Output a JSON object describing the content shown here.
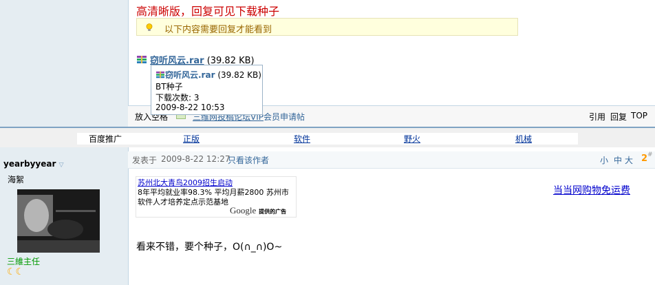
{
  "post1": {
    "headline": "高清晰版，回复可见下载种子",
    "locked_notice": "以下内容需要回复才能看到",
    "attachment": {
      "name": "窃听风云.rar",
      "size": "(39.82 KB)"
    },
    "tooltip": {
      "name": "窃听风云.rar",
      "size": "(39.82 KB)",
      "desc": "BT种子",
      "downloads": "下载次数: 3",
      "date": "2009-8-22 10:53"
    },
    "footer": {
      "favorite": "放入空格",
      "apply_prefix": "三维网投稿论坛VIP",
      "apply_link": "会员申请帖",
      "actions": [
        "引用",
        "回复",
        "TOP"
      ]
    }
  },
  "adbar": {
    "label": "百度推广",
    "links": [
      "正版",
      "软件",
      "野火",
      "机械"
    ]
  },
  "post2": {
    "author": "yearbyyear",
    "nickname": "海絮",
    "rank": "三維主任",
    "meta_prefix": "发表于",
    "timestamp": "2009-8-22 12:27",
    "only_author": "只看该作者",
    "font_sizes": [
      "小",
      "中",
      "大"
    ],
    "floor": "2",
    "floor_sup": "#",
    "google_ad": {
      "title": "苏州北大青鸟2009招生启动",
      "line1": "8年平均就业率98.3% 平均月薪2800 苏州市",
      "line2": "软件人才培养定点示范基地",
      "brand": "Google",
      "brand_suffix": "提供的广告"
    },
    "side_ad": "当当网购物免运费",
    "content": "看来不错，要个种子，O(∩_∩)O~"
  },
  "colors": {
    "headline": "#cc0000",
    "link": "#336699",
    "accent_gold": "#ff9900",
    "sidebar_bg": "#e5edf2"
  }
}
